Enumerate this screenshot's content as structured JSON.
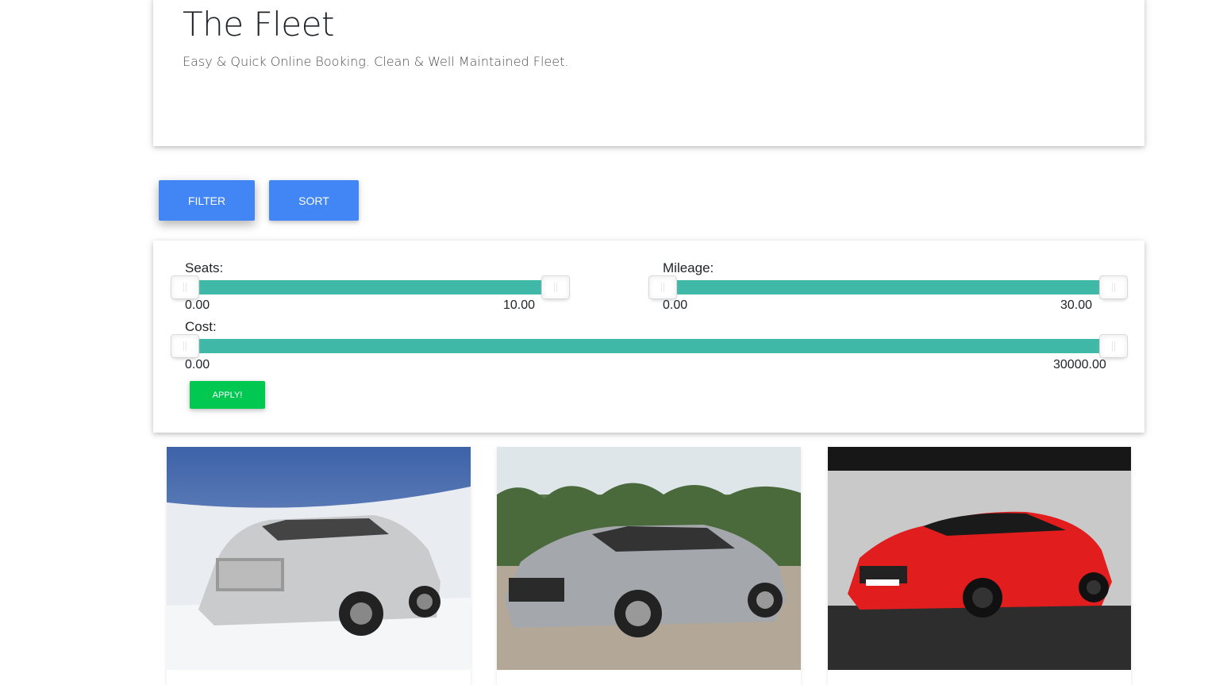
{
  "hero": {
    "title": "The Fleet",
    "subtitle": "Easy & Quick Online Booking. Clean & Well Maintained Fleet."
  },
  "toolbar": {
    "filter_label": "FILTER",
    "sort_label": "SORT"
  },
  "filters": {
    "seats": {
      "label": "Seats:",
      "min": "0.00",
      "max": "10.00",
      "low_fraction": 0,
      "high_fraction": 1
    },
    "mileage": {
      "label": "Mileage:",
      "min": "0.00",
      "max": "30.00",
      "low_fraction": 0,
      "high_fraction": 1
    },
    "cost": {
      "label": "Cost:",
      "min": "0.00",
      "max": "30000.00",
      "low_fraction": 0,
      "high_fraction": 1
    },
    "apply_label": "APPLY!"
  },
  "colors": {
    "primary": "#4285f4",
    "success": "#00c851",
    "slider_fill": "#3fb8a7"
  },
  "cars": [
    {
      "icon": "silver-sedan-photo"
    },
    {
      "icon": "grey-sedan-photo"
    },
    {
      "icon": "red-sedan-photo"
    }
  ]
}
